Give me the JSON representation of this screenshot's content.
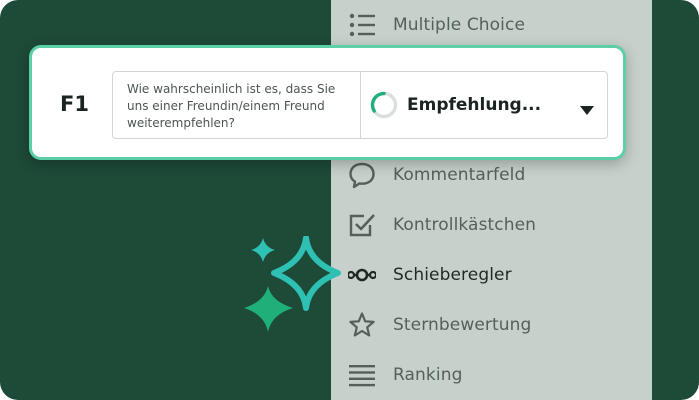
{
  "question": {
    "number": "F1",
    "text": "Wie wahrscheinlich ist es, dass Sie uns einer Freundin/einem Freund weiterempfehlen?",
    "type_selected": "Empfehlung..."
  },
  "question_types": [
    {
      "label": "Multiple Choice",
      "icon": "list-icon"
    },
    {
      "label": "Kommentarfeld",
      "icon": "comment-icon"
    },
    {
      "label": "Kontrollkästchen",
      "icon": "checkbox-icon"
    },
    {
      "label": "Schieberegler",
      "icon": "slider-icon"
    },
    {
      "label": "Sternbewertung",
      "icon": "star-icon"
    },
    {
      "label": "Ranking",
      "icon": "ranking-icon"
    }
  ],
  "colors": {
    "background": "#1e4a38",
    "panel": "#c7d1cc",
    "accent": "#5ccfa7",
    "sparkle_green": "#1fb07a",
    "sparkle_teal": "#2fc0b4"
  }
}
